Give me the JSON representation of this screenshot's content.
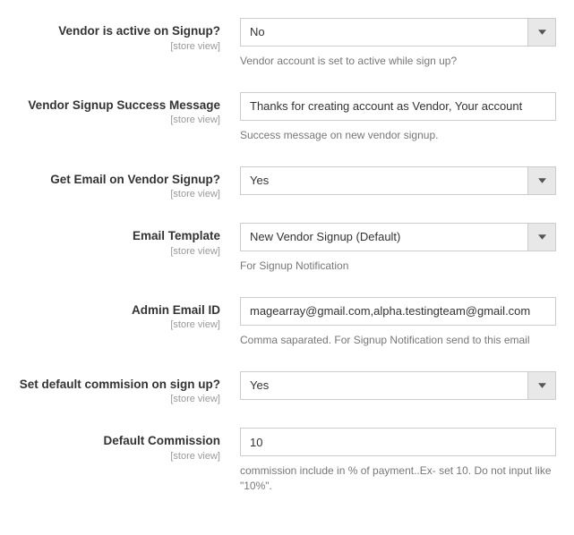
{
  "scope_label": "[store view]",
  "fields": {
    "vendor_active": {
      "label": "Vendor is active on Signup?",
      "value": "No",
      "help": "Vendor account is set to active while sign up?"
    },
    "success_message": {
      "label": "Vendor Signup Success Message",
      "value": "Thanks for creating account as Vendor, Your account",
      "help": "Success message on new vendor signup."
    },
    "get_email": {
      "label": "Get Email on Vendor Signup?",
      "value": "Yes",
      "help": ""
    },
    "email_template": {
      "label": "Email Template",
      "value": "New Vendor Signup (Default)",
      "help": "For Signup Notification"
    },
    "admin_email": {
      "label": "Admin Email ID",
      "value": "magearray@gmail.com,alpha.testingteam@gmail.com",
      "help": "Comma saparated. For Signup Notification send to this email"
    },
    "default_commission_flag": {
      "label": "Set default commision on sign up?",
      "value": "Yes",
      "help": ""
    },
    "default_commission": {
      "label": "Default Commission",
      "value": "10",
      "help": "commission include in % of payment..Ex- set 10. Do not input like \"10%\"."
    }
  }
}
